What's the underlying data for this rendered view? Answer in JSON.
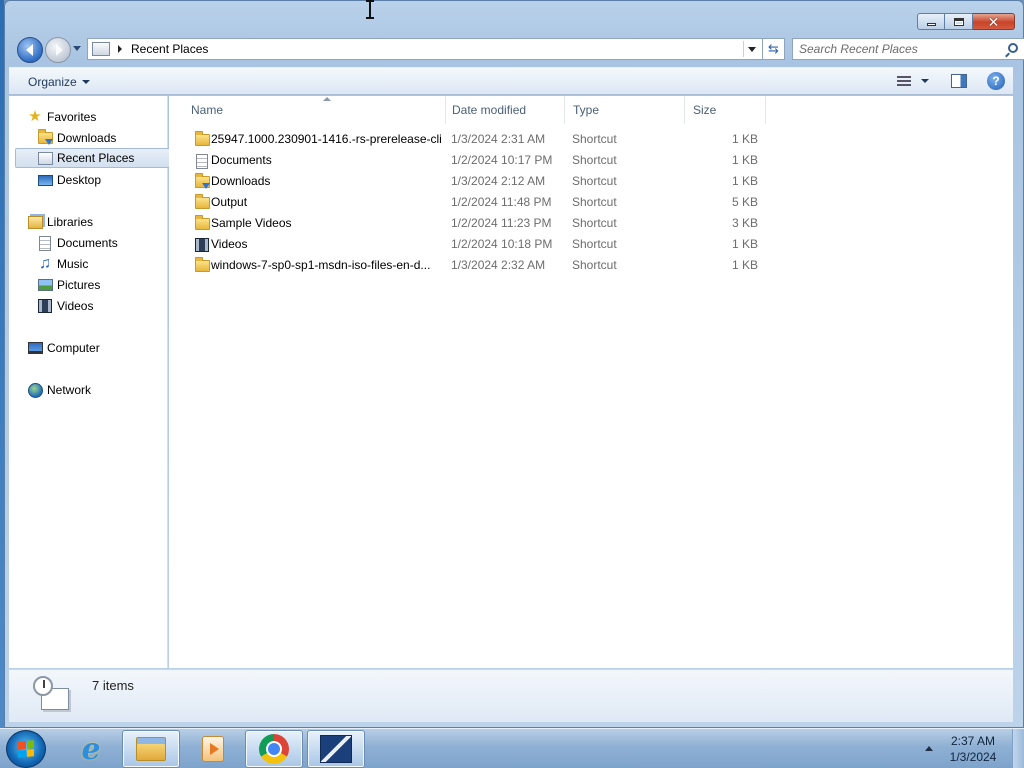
{
  "window": {
    "address": "Recent Places",
    "search_placeholder": "Search Recent Places",
    "caption": {
      "close_glyph": "✕"
    }
  },
  "toolbar": {
    "organize_label": "Organize",
    "help_glyph": "?"
  },
  "navigation": {
    "favorites": {
      "label": "Favorites",
      "items": [
        "Downloads",
        "Recent Places",
        "Desktop"
      ],
      "selected": "Recent Places"
    },
    "libraries": {
      "label": "Libraries",
      "items": [
        "Documents",
        "Music",
        "Pictures",
        "Videos"
      ]
    },
    "computer_label": "Computer",
    "network_label": "Network",
    "refresh_glyph": "⇆"
  },
  "columns": {
    "name": "Name",
    "date_modified": "Date modified",
    "type": "Type",
    "size": "Size"
  },
  "files": [
    {
      "name": "25947.1000.230901-1416.-rs-prerelease-cli...",
      "date": "1/3/2024 2:31 AM",
      "type": "Shortcut",
      "size": "1 KB",
      "icon": "folder-icon"
    },
    {
      "name": "Documents",
      "date": "1/2/2024 10:17 PM",
      "type": "Shortcut",
      "size": "1 KB",
      "icon": "document-icon"
    },
    {
      "name": "Downloads",
      "date": "1/3/2024 2:12 AM",
      "type": "Shortcut",
      "size": "1 KB",
      "icon": "downloads-folder-icon"
    },
    {
      "name": "Output",
      "date": "1/2/2024 11:48 PM",
      "type": "Shortcut",
      "size": "5 KB",
      "icon": "folder-icon"
    },
    {
      "name": "Sample Videos",
      "date": "1/2/2024 11:23 PM",
      "type": "Shortcut",
      "size": "3 KB",
      "icon": "folder-icon"
    },
    {
      "name": "Videos",
      "date": "1/2/2024 10:18 PM",
      "type": "Shortcut",
      "size": "1 KB",
      "icon": "video-icon"
    },
    {
      "name": "windows-7-sp0-sp1-msdn-iso-files-en-d...",
      "date": "1/3/2024 2:32 AM",
      "type": "Shortcut",
      "size": "1 KB",
      "icon": "folder-icon"
    }
  ],
  "details": {
    "item_count": "7 items"
  },
  "taskbar": {
    "time": "2:37 AM",
    "date": "1/3/2024",
    "ie_glyph": "e",
    "pinned": [
      "internet-explorer-icon",
      "windows-explorer-icon",
      "media-player-icon",
      "chrome-icon",
      "media-app-icon"
    ]
  },
  "colors": {
    "accent": "#2f6cc3",
    "selection": "#d3e0ef",
    "close_button": "#c7442a"
  }
}
